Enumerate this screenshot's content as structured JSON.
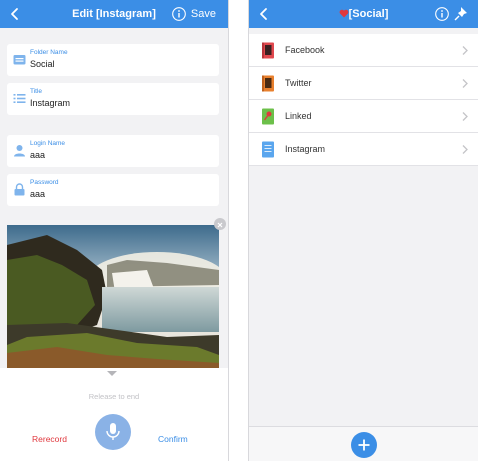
{
  "left_screen": {
    "title": "Edit [Instagram]",
    "save_label": "Save",
    "fields": [
      {
        "label": "Folder Name",
        "value": "Social",
        "icon": "folder-icon"
      },
      {
        "label": "Title",
        "value": "Instagram",
        "icon": "list-icon"
      },
      {
        "label": "Login Name",
        "value": "aaa",
        "icon": "user-icon"
      },
      {
        "label": "Password",
        "value": "aaa",
        "icon": "lock-icon"
      }
    ],
    "photo": {
      "icon": "waterfall-landscape-photo"
    },
    "recorder": {
      "hint": "Release to end",
      "rerecord_label": "Rerecord",
      "confirm_label": "Confirm"
    }
  },
  "right_screen": {
    "title": "[Social]",
    "title_icon": "heart-icon",
    "items": [
      {
        "label": "Facebook",
        "icon": "red-notebook-icon",
        "color": "#e0484e"
      },
      {
        "label": "Twitter",
        "icon": "orange-book-icon",
        "color": "#e8802e"
      },
      {
        "label": "Linked",
        "icon": "green-pin-note-icon",
        "color": "#6cc04a"
      },
      {
        "label": "Instagram",
        "icon": "blue-document-icon",
        "color": "#5aa6ee"
      }
    ]
  },
  "colors": {
    "accent": "#3b8ee6",
    "danger": "#e0383e",
    "background": "#f2f2f4"
  }
}
